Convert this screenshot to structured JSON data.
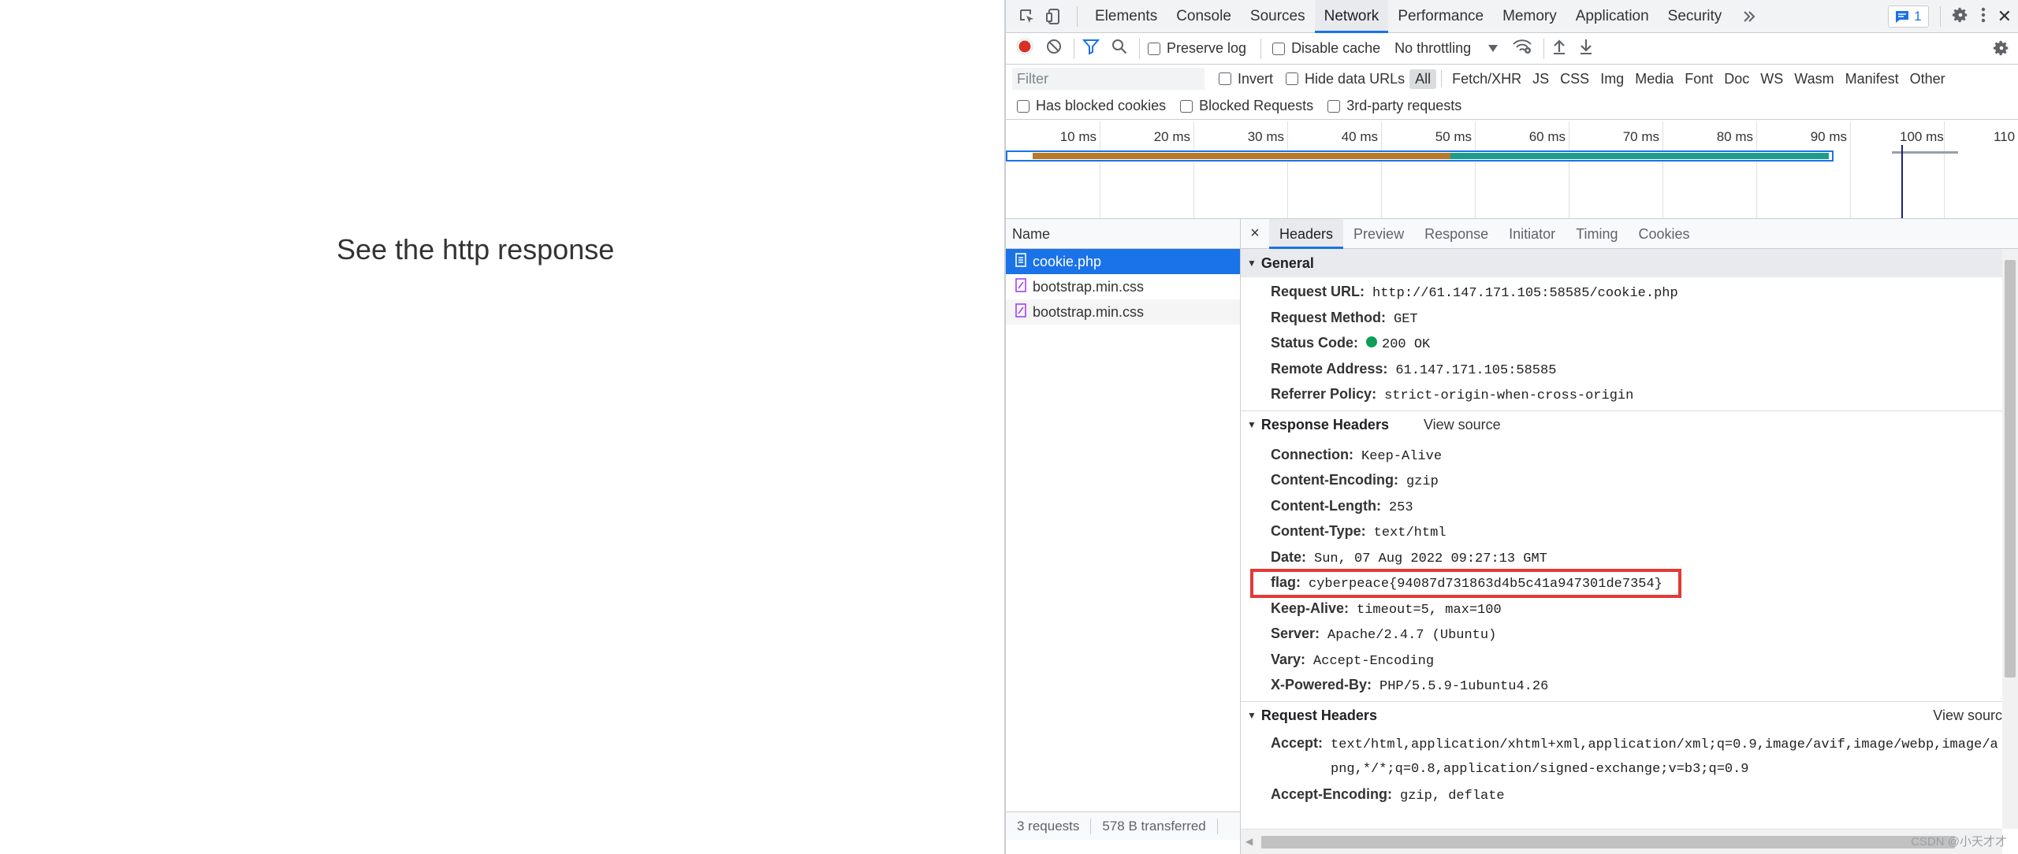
{
  "page": {
    "heading": "See the http response"
  },
  "devtools": {
    "tabs": [
      "Elements",
      "Console",
      "Sources",
      "Network",
      "Performance",
      "Memory",
      "Application",
      "Security"
    ],
    "active_tab": "Network",
    "more_tabs_icon": "double-chevron-icon",
    "messages_count": "1",
    "close_glyph": "✕",
    "toolbar": {
      "preserve_log": "Preserve log",
      "disable_cache": "Disable cache",
      "throttling": "No throttling"
    },
    "filter": {
      "placeholder": "Filter",
      "invert": "Invert",
      "hide_data_urls": "Hide data URLs",
      "types": [
        "All",
        "Fetch/XHR",
        "JS",
        "CSS",
        "Img",
        "Media",
        "Font",
        "Doc",
        "WS",
        "Wasm",
        "Manifest",
        "Other"
      ],
      "active_type": "All",
      "has_blocked_cookies": "Has blocked cookies",
      "blocked_requests": "Blocked Requests",
      "third_party": "3rd-party requests"
    },
    "timeline": {
      "ticks": [
        "10 ms",
        "20 ms",
        "30 ms",
        "40 ms",
        "50 ms",
        "60 ms",
        "70 ms",
        "80 ms",
        "90 ms",
        "100 ms",
        "110 ms"
      ],
      "bar_colors": {
        "waiting": "#b87a2a",
        "download": "#1e9e8a",
        "queue": "#1a73e8",
        "marker": "#1a237e"
      }
    },
    "requests": {
      "column_name": "Name",
      "items": [
        "cookie.php",
        "bootstrap.min.css",
        "bootstrap.min.css"
      ],
      "selected": "cookie.php",
      "summary_count": "3 requests",
      "summary_transferred": "578 B transferred"
    },
    "detail": {
      "close_glyph": "×",
      "tabs": [
        "Headers",
        "Preview",
        "Response",
        "Initiator",
        "Timing",
        "Cookies"
      ],
      "active_tab": "Headers",
      "general": {
        "title": "General",
        "rows": [
          {
            "k": "Request URL:",
            "v": "http://61.147.171.105:58585/cookie.php"
          },
          {
            "k": "Request Method:",
            "v": "GET"
          },
          {
            "k": "Status Code:",
            "v": "200 OK"
          },
          {
            "k": "Remote Address:",
            "v": "61.147.171.105:58585"
          },
          {
            "k": "Referrer Policy:",
            "v": "strict-origin-when-cross-origin"
          }
        ]
      },
      "response_headers": {
        "title": "Response Headers",
        "view_source": "View source",
        "rows": [
          {
            "k": "Connection:",
            "v": "Keep-Alive"
          },
          {
            "k": "Content-Encoding:",
            "v": "gzip"
          },
          {
            "k": "Content-Length:",
            "v": "253"
          },
          {
            "k": "Content-Type:",
            "v": "text/html"
          },
          {
            "k": "Date:",
            "v": "Sun, 07 Aug 2022 09:27:13 GMT"
          },
          {
            "k": "flag:",
            "v": "cyberpeace{94087d731863d4b5c41a947301de7354}"
          },
          {
            "k": "Keep-Alive:",
            "v": "timeout=5, max=100"
          },
          {
            "k": "Server:",
            "v": "Apache/2.4.7 (Ubuntu)"
          },
          {
            "k": "Vary:",
            "v": "Accept-Encoding"
          },
          {
            "k": "X-Powered-By:",
            "v": "PHP/5.5.9-1ubuntu4.26"
          }
        ]
      },
      "request_headers": {
        "title": "Request Headers",
        "view_source": "View sourc",
        "rows": [
          {
            "k": "Accept:",
            "v": "text/html,application/xhtml+xml,application/xml;q=0.9,image/avif,image/webp,image/apng,*/*;q=0.8,application/signed-exchange;v=b3;q=0.9"
          },
          {
            "k": "Accept-Encoding:",
            "v": "gzip, deflate"
          }
        ]
      },
      "highlight_color": "#e53935",
      "status_color": "#0f9d58"
    },
    "watermark": "CSDN @小天才才"
  }
}
